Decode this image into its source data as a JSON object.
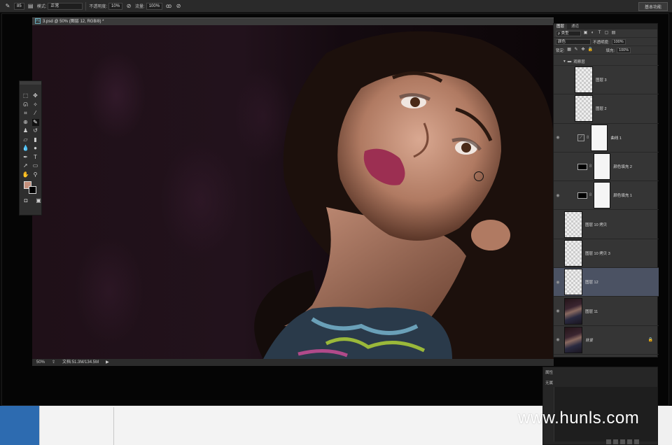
{
  "options_bar": {
    "brush_size": "85",
    "mode_label": "模式:",
    "mode_value": "正常",
    "opacity_label": "不透明度:",
    "opacity_value": "10%",
    "flow_label": "流量:",
    "flow_value": "100%",
    "workspace": "基本功能"
  },
  "document": {
    "tab_title": "3.psd @ 50% (图层 12, RGB/8) *",
    "zoom": "50%",
    "doc_info": "文档:51.3M/134.5M"
  },
  "colors": {
    "foreground": "#c48f7b",
    "background": "#000000",
    "selected_layer": "#4b5263"
  },
  "layers_panel": {
    "tabs": [
      "图层",
      "通道"
    ],
    "filter_label": "ρ 类型",
    "blend_mode": "颜色",
    "opacity_label": "不透明度:",
    "opacity_value": "100%",
    "lock_label": "锁定:",
    "fill_label": "填充:",
    "fill_value": "100%",
    "group_name": "观察层",
    "layers": [
      {
        "name": "图层 3",
        "kind": "transparent"
      },
      {
        "name": "图层 2",
        "kind": "transparent"
      },
      {
        "name": "曲线 1",
        "kind": "curves"
      },
      {
        "name": "颜色填充 2",
        "kind": "fill"
      },
      {
        "name": "颜色填充 1",
        "kind": "fill"
      },
      {
        "name": "图层 10 拷贝",
        "kind": "transparent"
      },
      {
        "name": "图层 10 拷贝 3",
        "kind": "transparent"
      },
      {
        "name": "图层 12",
        "kind": "transparent",
        "selected": true
      },
      {
        "name": "图层 11",
        "kind": "photo"
      },
      {
        "name": "背景",
        "kind": "photo",
        "locked": true
      }
    ]
  },
  "lower_panel": {
    "tab": "属性",
    "subtitle": "无属"
  },
  "watermark": "www.hunls.com"
}
